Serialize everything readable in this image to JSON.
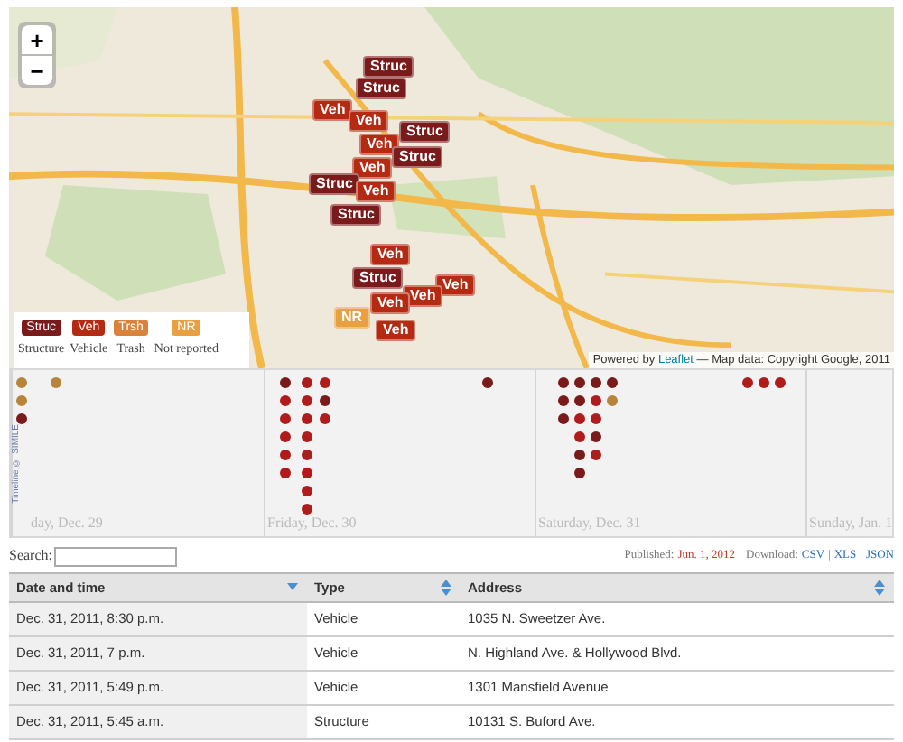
{
  "map": {
    "zoom_in": "+",
    "zoom_out": "−",
    "markers": [
      {
        "kind": "struc",
        "label": "Struc"
      },
      {
        "kind": "struc",
        "label": "Struc"
      },
      {
        "kind": "veh",
        "label": "Veh"
      },
      {
        "kind": "veh",
        "label": "Veh"
      },
      {
        "kind": "struc",
        "label": "Struc"
      },
      {
        "kind": "veh",
        "label": "Veh"
      },
      {
        "kind": "struc",
        "label": "Struc"
      },
      {
        "kind": "veh",
        "label": "Veh"
      },
      {
        "kind": "struc",
        "label": "Struc"
      },
      {
        "kind": "veh",
        "label": "Veh"
      },
      {
        "kind": "struc",
        "label": "Struc"
      },
      {
        "kind": "veh",
        "label": "Veh"
      },
      {
        "kind": "struc",
        "label": "Struc"
      },
      {
        "kind": "veh",
        "label": "Veh"
      },
      {
        "kind": "veh",
        "label": "Veh"
      },
      {
        "kind": "veh",
        "label": "Veh"
      },
      {
        "kind": "nr",
        "label": "NR"
      },
      {
        "kind": "veh",
        "label": "Veh"
      }
    ],
    "legend": [
      {
        "kind": "struc",
        "tag": "Struc",
        "label": "Structure"
      },
      {
        "kind": "veh",
        "tag": "Veh",
        "label": "Vehicle"
      },
      {
        "kind": "trsh",
        "tag": "Trsh",
        "label": "Trash"
      },
      {
        "kind": "nr",
        "tag": "NR",
        "label": "Not reported"
      }
    ],
    "attribution": {
      "prefix": "Powered by",
      "link": "Leaflet",
      "suffix": "— Map data: Copyright Google, 2011"
    }
  },
  "timeline": {
    "credit": "Timeline © SIMILE",
    "days": [
      "day, Dec. 29",
      "Friday, Dec. 30",
      "Saturday, Dec. 31",
      "Sunday, Jan. 1"
    ],
    "stacks": [
      {
        "dots": [
          {
            "color": "#b8843a"
          },
          {
            "color": "#b8843a"
          },
          {
            "color": "#7a1a1a"
          }
        ]
      },
      {
        "dots": [
          {
            "color": "#b8843a"
          }
        ]
      },
      {
        "dots": [
          {
            "color": "#7a1a1a"
          },
          {
            "color": "#b01c1c"
          },
          {
            "color": "#b01c1c"
          },
          {
            "color": "#b01c1c"
          },
          {
            "color": "#b01c1c"
          },
          {
            "color": "#b01c1c"
          }
        ]
      },
      {
        "dots": [
          {
            "color": "#b01c1c"
          },
          {
            "color": "#b01c1c"
          },
          {
            "color": "#b01c1c"
          },
          {
            "color": "#b01c1c"
          },
          {
            "color": "#b01c1c"
          },
          {
            "color": "#b01c1c"
          },
          {
            "color": "#b01c1c"
          },
          {
            "color": "#b01c1c"
          }
        ]
      },
      {
        "dots": [
          {
            "color": "#b01c1c"
          },
          {
            "color": "#7a1a1a"
          },
          {
            "color": "#b01c1c"
          }
        ]
      },
      {
        "dots": [
          {
            "color": "#7a1a1a"
          }
        ]
      },
      {
        "dots": [
          {
            "color": "#7a1a1a"
          },
          {
            "color": "#7a1a1a"
          },
          {
            "color": "#7a1a1a"
          }
        ]
      },
      {
        "dots": [
          {
            "color": "#7a1a1a"
          },
          {
            "color": "#7a1a1a"
          },
          {
            "color": "#b01c1c"
          },
          {
            "color": "#b01c1c"
          },
          {
            "color": "#7a1a1a"
          },
          {
            "color": "#7a1a1a"
          }
        ]
      },
      {
        "dots": [
          {
            "color": "#7a1a1a"
          },
          {
            "color": "#b01c1c"
          },
          {
            "color": "#b01c1c"
          },
          {
            "color": "#7a1a1a"
          },
          {
            "color": "#b01c1c"
          }
        ]
      },
      {
        "dots": [
          {
            "color": "#7a1a1a"
          },
          {
            "color": "#b8843a"
          }
        ]
      },
      {
        "dots": [
          {
            "color": "#b01c1c"
          }
        ]
      },
      {
        "dots": [
          {
            "color": "#b01c1c"
          }
        ]
      },
      {
        "dots": [
          {
            "color": "#b01c1c"
          }
        ]
      }
    ]
  },
  "search": {
    "label": "Search:"
  },
  "meta": {
    "published_label": "Published:",
    "published_date": "Jun. 1, 2012",
    "download_label": "Download:",
    "formats": [
      "CSV",
      "XLS",
      "JSON"
    ],
    "separator": "|"
  },
  "table": {
    "columns": [
      {
        "label": "Date and time",
        "sorted": true
      },
      {
        "label": "Type",
        "sorted": false
      },
      {
        "label": "Address",
        "sorted": false
      }
    ],
    "rows": [
      [
        "Dec. 31, 2011, 8:30 p.m.",
        "Vehicle",
        "1035 N. Sweetzer Ave."
      ],
      [
        "Dec. 31, 2011, 7 p.m.",
        "Vehicle",
        "N. Highland Ave. & Hollywood Blvd."
      ],
      [
        "Dec. 31, 2011, 5:49 p.m.",
        "Vehicle",
        "1301 Mansfield Avenue"
      ],
      [
        "Dec. 31, 2011, 5:45 a.m.",
        "Structure",
        "10131 S. Buford Ave."
      ]
    ]
  }
}
